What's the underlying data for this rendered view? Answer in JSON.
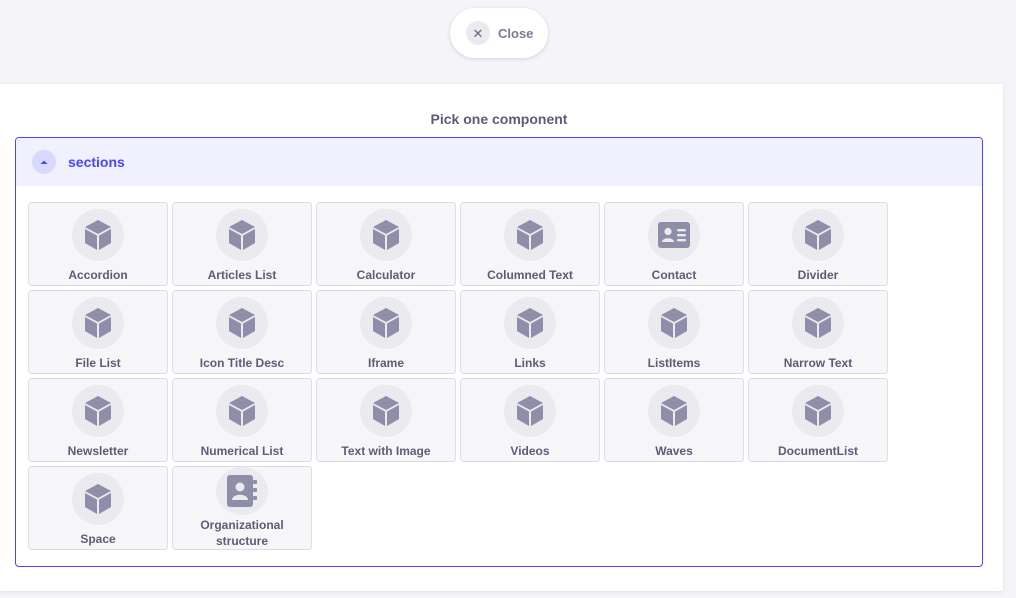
{
  "close_button": {
    "label": "Close",
    "icon": "close-icon"
  },
  "panel": {
    "title": "Pick one component"
  },
  "section": {
    "label": "sections",
    "toggle_icon": "caret-up-icon",
    "accent": "#4945ff"
  },
  "components": [
    {
      "label": "Accordion",
      "icon": "cube-icon"
    },
    {
      "label": "Articles List",
      "icon": "cube-icon"
    },
    {
      "label": "Calculator",
      "icon": "cube-icon"
    },
    {
      "label": "Columned Text",
      "icon": "cube-icon"
    },
    {
      "label": "Contact",
      "icon": "contact-card-icon"
    },
    {
      "label": "Divider",
      "icon": "cube-icon"
    },
    {
      "label": "File List",
      "icon": "cube-icon"
    },
    {
      "label": "Icon Title Desc",
      "icon": "cube-icon"
    },
    {
      "label": "Iframe",
      "icon": "cube-icon"
    },
    {
      "label": "Links",
      "icon": "cube-icon"
    },
    {
      "label": "ListItems",
      "icon": "cube-icon"
    },
    {
      "label": "Narrow Text",
      "icon": "cube-icon"
    },
    {
      "label": "Newsletter",
      "icon": "cube-icon"
    },
    {
      "label": "Numerical List",
      "icon": "cube-icon"
    },
    {
      "label": "Text with Image",
      "icon": "cube-icon"
    },
    {
      "label": "Videos",
      "icon": "cube-icon"
    },
    {
      "label": "Waves",
      "icon": "cube-icon"
    },
    {
      "label": "DocumentList",
      "icon": "cube-icon"
    },
    {
      "label": "Space",
      "icon": "cube-icon"
    },
    {
      "label": "Organizational structure",
      "icon": "address-book-icon"
    }
  ]
}
